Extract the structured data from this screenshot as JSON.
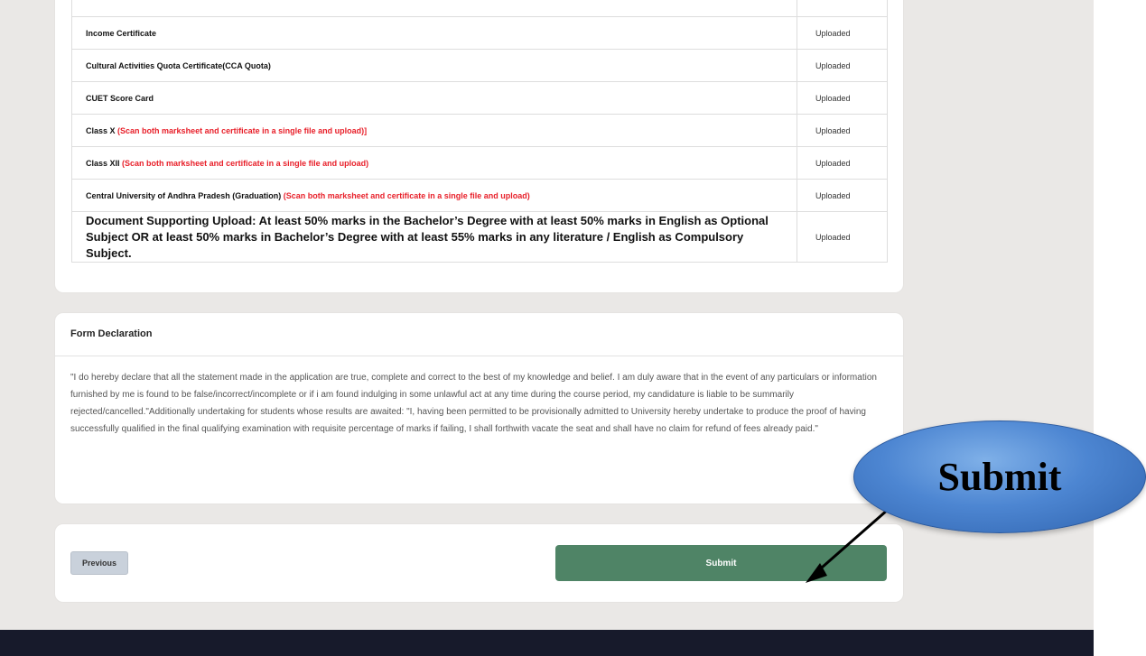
{
  "documents": {
    "rows": [
      {
        "name": "Income Certificate",
        "note": "",
        "status": "Uploaded"
      },
      {
        "name": "Cultural Activities Quota Certificate(CCA Quota)",
        "note": "",
        "status": "Uploaded"
      },
      {
        "name": "CUET Score Card",
        "note": "",
        "status": "Uploaded"
      },
      {
        "name": "Class X",
        "note": "(Scan both marksheet and certificate in a single file and upload)]",
        "status": "Uploaded"
      },
      {
        "name": "Class XII",
        "note": "(Scan both marksheet and certificate in a single file and upload)",
        "status": "Uploaded"
      },
      {
        "name": "Central University of Andhra Pradesh (Graduation)",
        "note": "(Scan both marksheet and certificate in a single file and upload)",
        "status": "Uploaded"
      },
      {
        "name": "Document Supporting Upload: At least 50% marks in the Bachelor’s Degree with at least 50% marks in English as Optional Subject OR at least 50% marks in Bachelor’s Degree with at least 55% marks in any literature / English as Compulsory Subject.",
        "note": "",
        "status": "Uploaded"
      }
    ]
  },
  "declaration": {
    "title": "Form Declaration",
    "text": "\"I do hereby declare that all the statement made in the application are true, complete and correct to the best of my knowledge and belief. I am duly aware that in the event of any particulars or information furnished by me is found to be false/incorrect/incomplete or if i am found indulging in some unlawful act at any time during the course period, my candidature is liable to be summarily rejected/cancelled.\"Additionally undertaking for students whose results are awaited: \"I, having been permitted to be provisionally admitted to University hereby undertake to produce the proof of having successfully qualified in the final qualifying examination with requisite percentage of marks if failing, I shall forthwith vacate the seat and shall have no claim for refund of fees already paid.\""
  },
  "actions": {
    "previous_label": "Previous",
    "submit_label": "Submit"
  },
  "callout": {
    "label": "Submit"
  },
  "colors": {
    "submit": "#4f8466",
    "note": "#e8202a",
    "footer": "#171a2b",
    "callout": "#4d86d2"
  }
}
